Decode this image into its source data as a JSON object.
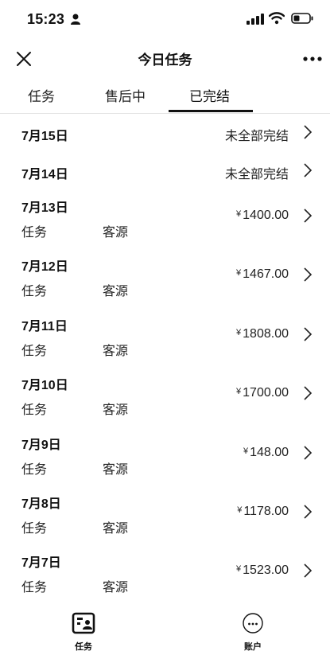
{
  "status_bar": {
    "time": "15:23"
  },
  "nav": {
    "title": "今日任务"
  },
  "tabs": [
    {
      "label": "任务"
    },
    {
      "label": "售后中"
    },
    {
      "label": "已完结"
    }
  ],
  "active_tab": "已完结",
  "simple_rows": [
    {
      "date": "7月15日",
      "status": "未全部完结"
    },
    {
      "date": "7月14日",
      "status": "未全部完结"
    }
  ],
  "rows": [
    {
      "date": "7月13日",
      "task": "任务",
      "source": "客源",
      "currency": "¥",
      "amount": "1400.00"
    },
    {
      "date": "7月12日",
      "task": "任务",
      "source": "客源",
      "currency": "¥",
      "amount": "1467.00"
    },
    {
      "date": "7月11日",
      "task": "任务",
      "source": "客源",
      "currency": "¥",
      "amount": "1808.00"
    },
    {
      "date": "7月10日",
      "task": "任务",
      "source": "客源",
      "currency": "¥",
      "amount": "1700.00"
    },
    {
      "date": "7月9日",
      "task": "任务",
      "source": "客源",
      "currency": "¥",
      "amount": "148.00"
    },
    {
      "date": "7月8日",
      "task": "任务",
      "source": "客源",
      "currency": "¥",
      "amount": "1178.00"
    },
    {
      "date": "7月7日",
      "task": "任务",
      "source": "客源",
      "currency": "¥",
      "amount": "1523.00"
    }
  ],
  "tabbar": [
    {
      "label": "任务",
      "icon": "task-icon"
    },
    {
      "label": "账户",
      "icon": "account-icon"
    }
  ]
}
